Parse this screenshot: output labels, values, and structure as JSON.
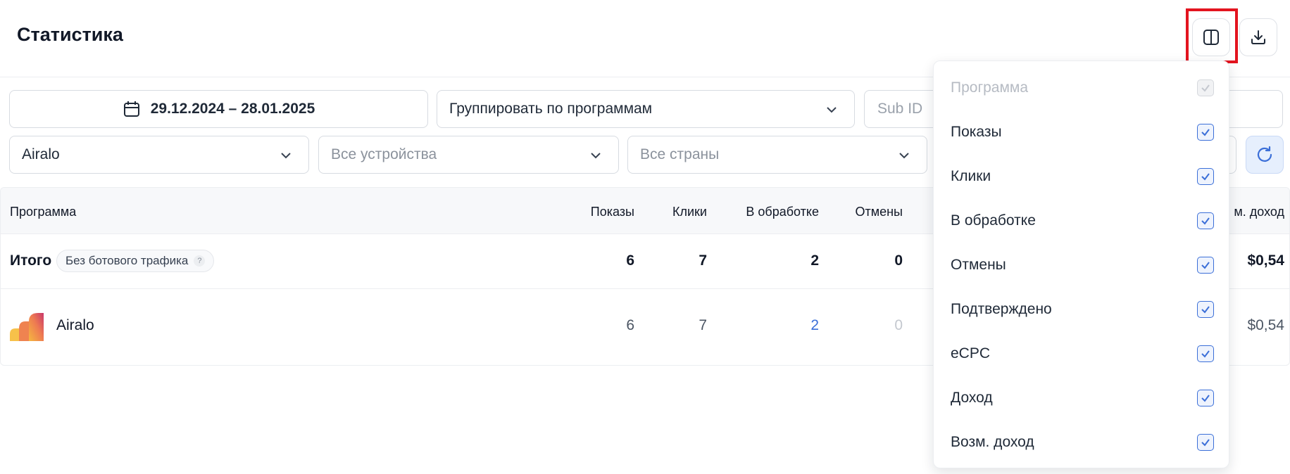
{
  "header": {
    "title": "Статистика",
    "columns_button_icon": "columns-icon",
    "download_button_icon": "download-icon"
  },
  "filters": {
    "date_range": "29.12.2024 – 28.01.2025",
    "group_by": "Группировать по программам",
    "subid_placeholder": "Sub ID",
    "program": "Airalo",
    "devices_placeholder": "Все устройства",
    "countries_placeholder": "Все страны",
    "refresh_icon": "refresh-icon"
  },
  "table": {
    "columns": [
      "Программа",
      "Показы",
      "Клики",
      "В обработке",
      "Отмены",
      "м. доход"
    ],
    "total": {
      "label": "Итого",
      "badge": "Без ботового трафика",
      "badge_hint": "?",
      "shows": "6",
      "clicks": "7",
      "processing": "2",
      "cancels": "0",
      "income": "$0,54"
    },
    "rows": [
      {
        "name": "Airalo",
        "shows": "6",
        "clicks": "7",
        "processing": "2",
        "cancels": "0",
        "income": "$0,54"
      }
    ]
  },
  "column_menu": {
    "items": [
      {
        "label": "Программа",
        "checked": true,
        "disabled": true
      },
      {
        "label": "Показы",
        "checked": true,
        "disabled": false
      },
      {
        "label": "Клики",
        "checked": true,
        "disabled": false
      },
      {
        "label": "В обработке",
        "checked": true,
        "disabled": false
      },
      {
        "label": "Отмены",
        "checked": true,
        "disabled": false
      },
      {
        "label": "Подтверждено",
        "checked": true,
        "disabled": false
      },
      {
        "label": "eCPC",
        "checked": true,
        "disabled": false
      },
      {
        "label": "Доход",
        "checked": true,
        "disabled": false
      },
      {
        "label": "Возм. доход",
        "checked": true,
        "disabled": false
      }
    ]
  },
  "colors": {
    "accent": "#3b6fd8",
    "highlight": "#e3141f",
    "link_value": "#3b6fd8",
    "muted_value": "#c4c8cf"
  }
}
